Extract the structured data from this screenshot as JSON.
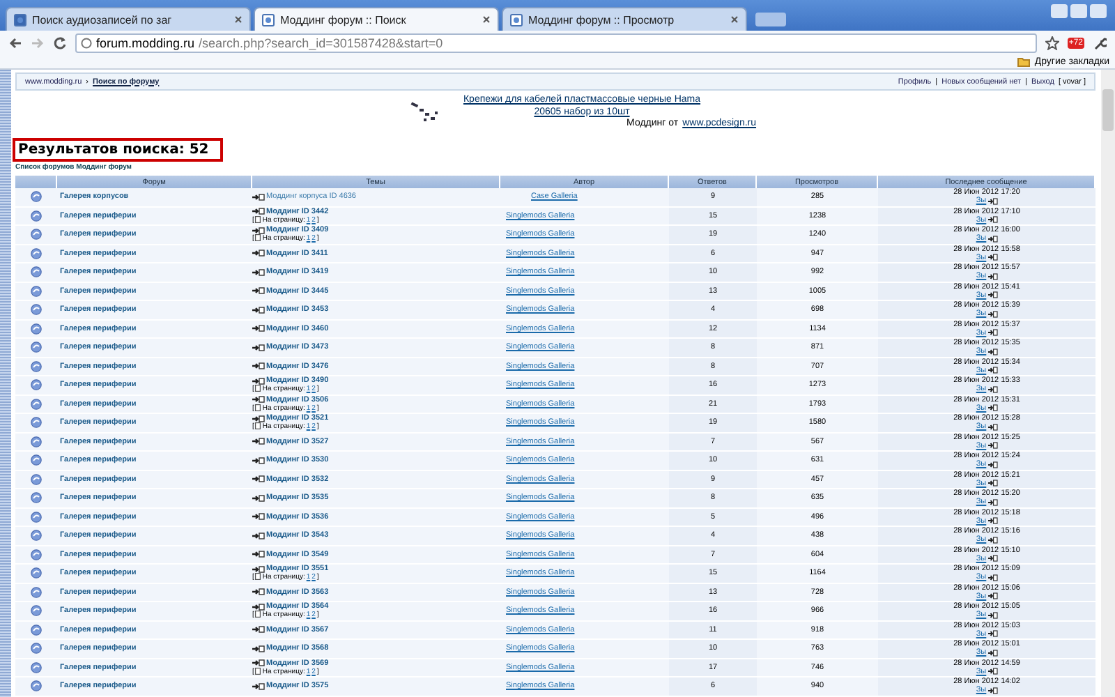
{
  "browser": {
    "tabs": [
      {
        "label": "Поиск аудиозаписей по заг",
        "selected": false
      },
      {
        "label": "Моддинг форум :: Поиск",
        "selected": true
      },
      {
        "label": "Моддинг форум :: Просмотр",
        "selected": false
      }
    ],
    "url_host": "forum.modding.ru",
    "url_path": "/search.php?search_id=301587428&start=0",
    "bookmarks": "Другие закладки",
    "badge": "+72"
  },
  "nav": {
    "breadcrumbs": [
      "www.modding.ru",
      "Поиск по форуму"
    ],
    "breadcrumb_separator": "›",
    "links": [
      "Профиль",
      "Новых сообщений нет",
      "Выход"
    ],
    "link_separators": [
      "|",
      "|"
    ],
    "user": "[ vovar ]"
  },
  "banner": {
    "lines": [
      "Крепежи для кабелей пластмассовые черные Hama",
      "20605 набор из 10шт"
    ],
    "byline": "Моддинг от",
    "site": "www.pcdesign.ru"
  },
  "results_title": "Результатов поиска: 52",
  "crumb": "Список форумов Моддинг форум",
  "table": {
    "columns": [
      "Форум",
      "Темы",
      "Автор",
      "Ответов",
      "Просмотров",
      "Последнее сообщение"
    ],
    "rows": [
      {
        "forum": "Галерея корпусов",
        "topic": "Моддинг корпуса ID 4636",
        "author": "Case Galleria",
        "replies": "9",
        "views": "285",
        "last": "28 Июн 2012 17:20",
        "last_by": "Зы"
      },
      {
        "forum": "Галерея периферии",
        "topic": "Моддинг ID 3442",
        "pages": {
          "open": "[",
          "label": "На страницу:",
          "links": [
            "1",
            "2"
          ],
          "close": "]"
        },
        "author": "Singlemods Galleria",
        "replies": "15",
        "views": "1238",
        "last": "28 Июн 2012 17:10",
        "last_by": "Зы"
      },
      {
        "forum": "Галерея периферии",
        "topic": "Моддинг ID 3409",
        "pages": {
          "open": "[",
          "label": "На страницу:",
          "links": [
            "1",
            "2"
          ],
          "close": "]"
        },
        "author": "Singlemods Galleria",
        "replies": "19",
        "views": "1240",
        "last": "28 Июн 2012 16:00",
        "last_by": "Зы"
      },
      {
        "forum": "Галерея периферии",
        "topic": "Моддинг ID 3411",
        "author": "Singlemods Galleria",
        "replies": "6",
        "views": "947",
        "last": "28 Июн 2012 15:58",
        "last_by": "Зы"
      },
      {
        "forum": "Галерея периферии",
        "topic": "Моддинг ID 3419",
        "author": "Singlemods Galleria",
        "replies": "10",
        "views": "992",
        "last": "28 Июн 2012 15:57",
        "last_by": "Зы"
      },
      {
        "forum": "Галерея периферии",
        "topic": "Моддинг ID 3445",
        "author": "Singlemods Galleria",
        "replies": "13",
        "views": "1005",
        "last": "28 Июн 2012 15:41",
        "last_by": "Зы"
      },
      {
        "forum": "Галерея периферии",
        "topic": "Моддинг ID 3453",
        "author": "Singlemods Galleria",
        "replies": "4",
        "views": "698",
        "last": "28 Июн 2012 15:39",
        "last_by": "Зы"
      },
      {
        "forum": "Галерея периферии",
        "topic": "Моддинг ID 3460",
        "author": "Singlemods Galleria",
        "replies": "12",
        "views": "1134",
        "last": "28 Июн 2012 15:37",
        "last_by": "Зы"
      },
      {
        "forum": "Галерея периферии",
        "topic": "Моддинг ID 3473",
        "author": "Singlemods Galleria",
        "replies": "8",
        "views": "871",
        "last": "28 Июн 2012 15:35",
        "last_by": "Зы"
      },
      {
        "forum": "Галерея периферии",
        "topic": "Моддинг ID 3476",
        "author": "Singlemods Galleria",
        "replies": "8",
        "views": "707",
        "last": "28 Июн 2012 15:34",
        "last_by": "Зы"
      },
      {
        "forum": "Галерея периферии",
        "topic": "Моддинг ID 3490",
        "pages": {
          "open": "[",
          "label": "На страницу:",
          "links": [
            "1",
            "2"
          ],
          "close": "]"
        },
        "author": "Singlemods Galleria",
        "replies": "16",
        "views": "1273",
        "last": "28 Июн 2012 15:33",
        "last_by": "Зы"
      },
      {
        "forum": "Галерея периферии",
        "topic": "Моддинг ID 3506",
        "pages": {
          "open": "[",
          "label": "На страницу:",
          "links": [
            "1",
            "2"
          ],
          "close": "]"
        },
        "author": "Singlemods Galleria",
        "replies": "21",
        "views": "1793",
        "last": "28 Июн 2012 15:31",
        "last_by": "Зы"
      },
      {
        "forum": "Галерея периферии",
        "topic": "Моддинг ID 3521",
        "pages": {
          "open": "[",
          "label": "На страницу:",
          "links": [
            "1",
            "2"
          ],
          "close": "]"
        },
        "author": "Singlemods Galleria",
        "replies": "19",
        "views": "1580",
        "last": "28 Июн 2012 15:28",
        "last_by": "Зы"
      },
      {
        "forum": "Галерея периферии",
        "topic": "Моддинг ID 3527",
        "author": "Singlemods Galleria",
        "replies": "7",
        "views": "567",
        "last": "28 Июн 2012 15:25",
        "last_by": "Зы"
      },
      {
        "forum": "Галерея периферии",
        "topic": "Моддинг ID 3530",
        "author": "Singlemods Galleria",
        "replies": "10",
        "views": "631",
        "last": "28 Июн 2012 15:24",
        "last_by": "Зы"
      },
      {
        "forum": "Галерея периферии",
        "topic": "Моддинг ID 3532",
        "author": "Singlemods Galleria",
        "replies": "9",
        "views": "457",
        "last": "28 Июн 2012 15:21",
        "last_by": "Зы"
      },
      {
        "forum": "Галерея периферии",
        "topic": "Моддинг ID 3535",
        "author": "Singlemods Galleria",
        "replies": "8",
        "views": "635",
        "last": "28 Июн 2012 15:20",
        "last_by": "Зы"
      },
      {
        "forum": "Галерея периферии",
        "topic": "Моддинг ID 3536",
        "author": "Singlemods Galleria",
        "replies": "5",
        "views": "496",
        "last": "28 Июн 2012 15:18",
        "last_by": "Зы"
      },
      {
        "forum": "Галерея периферии",
        "topic": "Моддинг ID 3543",
        "author": "Singlemods Galleria",
        "replies": "4",
        "views": "438",
        "last": "28 Июн 2012 15:16",
        "last_by": "Зы"
      },
      {
        "forum": "Галерея периферии",
        "topic": "Моддинг ID 3549",
        "author": "Singlemods Galleria",
        "replies": "7",
        "views": "604",
        "last": "28 Июн 2012 15:10",
        "last_by": "Зы"
      },
      {
        "forum": "Галерея периферии",
        "topic": "Моддинг ID 3551",
        "pages": {
          "open": "[",
          "label": "На страницу:",
          "links": [
            "1",
            "2"
          ],
          "close": "]"
        },
        "author": "Singlemods Galleria",
        "replies": "15",
        "views": "1164",
        "last": "28 Июн 2012 15:09",
        "last_by": "Зы"
      },
      {
        "forum": "Галерея периферии",
        "topic": "Моддинг ID 3563",
        "author": "Singlemods Galleria",
        "replies": "13",
        "views": "728",
        "last": "28 Июн 2012 15:06",
        "last_by": "Зы"
      },
      {
        "forum": "Галерея периферии",
        "topic": "Моддинг ID 3564",
        "pages": {
          "open": "[",
          "label": "На страницу:",
          "links": [
            "1",
            "2"
          ],
          "close": "]"
        },
        "author": "Singlemods Galleria",
        "replies": "16",
        "views": "966",
        "last": "28 Июн 2012 15:05",
        "last_by": "Зы"
      },
      {
        "forum": "Галерея периферии",
        "topic": "Моддинг ID 3567",
        "author": "Singlemods Galleria",
        "replies": "11",
        "views": "918",
        "last": "28 Июн 2012 15:03",
        "last_by": "Зы"
      },
      {
        "forum": "Галерея периферии",
        "topic": "Моддинг ID 3568",
        "author": "Singlemods Galleria",
        "replies": "10",
        "views": "763",
        "last": "28 Июн 2012 15:01",
        "last_by": "Зы"
      },
      {
        "forum": "Галерея периферии",
        "topic": "Моддинг ID 3569",
        "pages": {
          "open": "[",
          "label": "На страницу:",
          "links": [
            "1",
            "2"
          ],
          "close": "]"
        },
        "author": "Singlemods Galleria",
        "replies": "17",
        "views": "746",
        "last": "28 Июн 2012 14:59",
        "last_by": "Зы"
      },
      {
        "forum": "Галерея периферии",
        "topic": "Моддинг ID 3575",
        "author": "Singlemods Galleria",
        "replies": "6",
        "views": "940",
        "last": "28 Июн 2012 14:02",
        "last_by": "Зы"
      }
    ]
  }
}
